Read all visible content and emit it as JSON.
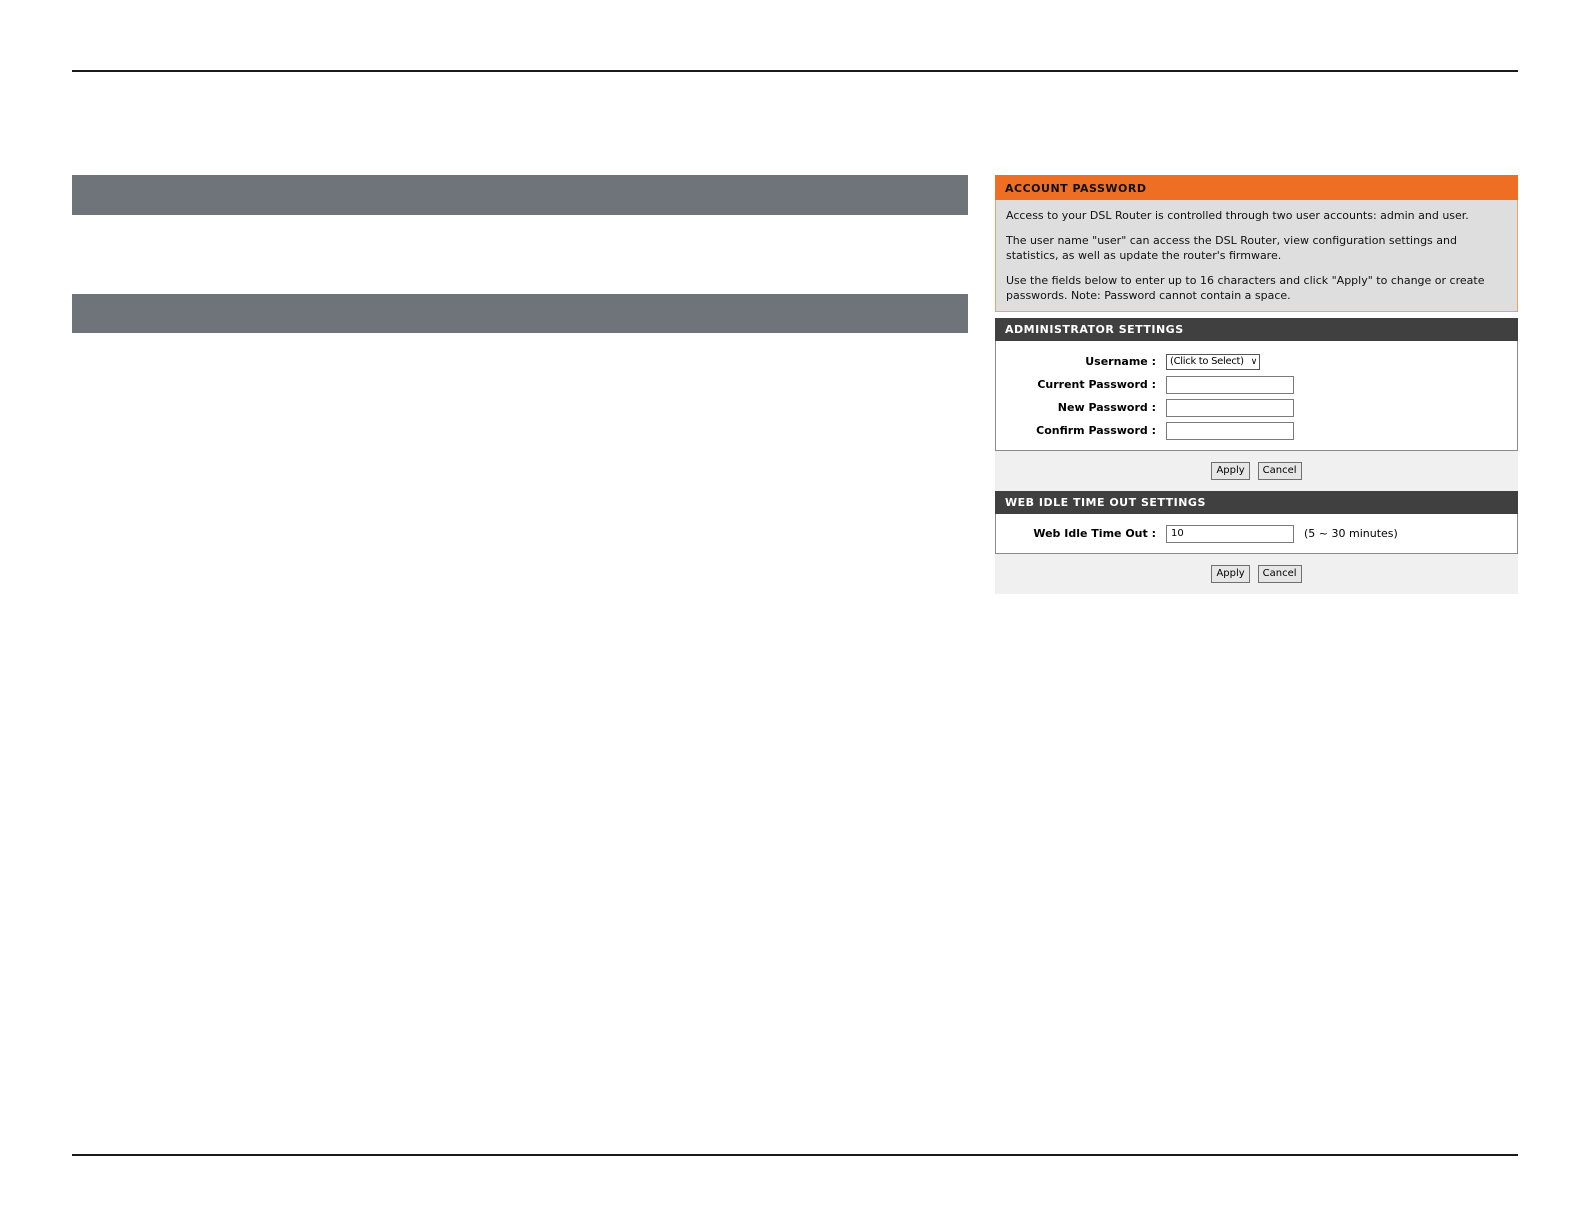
{
  "account_password": {
    "header": "ACCOUNT PASSWORD",
    "desc": [
      "Access to your DSL Router is controlled through two user accounts: admin and user.",
      "The user name \"user\" can access the DSL Router, view configuration settings and statistics, as well as update the router's firmware.",
      "Use the fields below to enter up to 16 characters and click \"Apply\" to change or create passwords. Note: Password cannot contain a space."
    ]
  },
  "admin_settings": {
    "header": "ADMINISTRATOR SETTINGS",
    "username_label": "Username :",
    "username_value": "(Click to Select)",
    "current_password_label": "Current Password :",
    "new_password_label": "New Password :",
    "confirm_password_label": "Confirm Password :",
    "current_password_value": "",
    "new_password_value": "",
    "confirm_password_value": "",
    "apply_label": "Apply",
    "cancel_label": "Cancel"
  },
  "idle_settings": {
    "header": "WEB IDLE TIME OUT SETTINGS",
    "label": "Web Idle Time Out  :",
    "value": "10",
    "hint": "(5 ~ 30 minutes)",
    "apply_label": "Apply",
    "cancel_label": "Cancel"
  },
  "colors": {
    "orange_header": "#ee6e24",
    "dark_header": "#404040",
    "gray_bar": "#6f747a"
  }
}
